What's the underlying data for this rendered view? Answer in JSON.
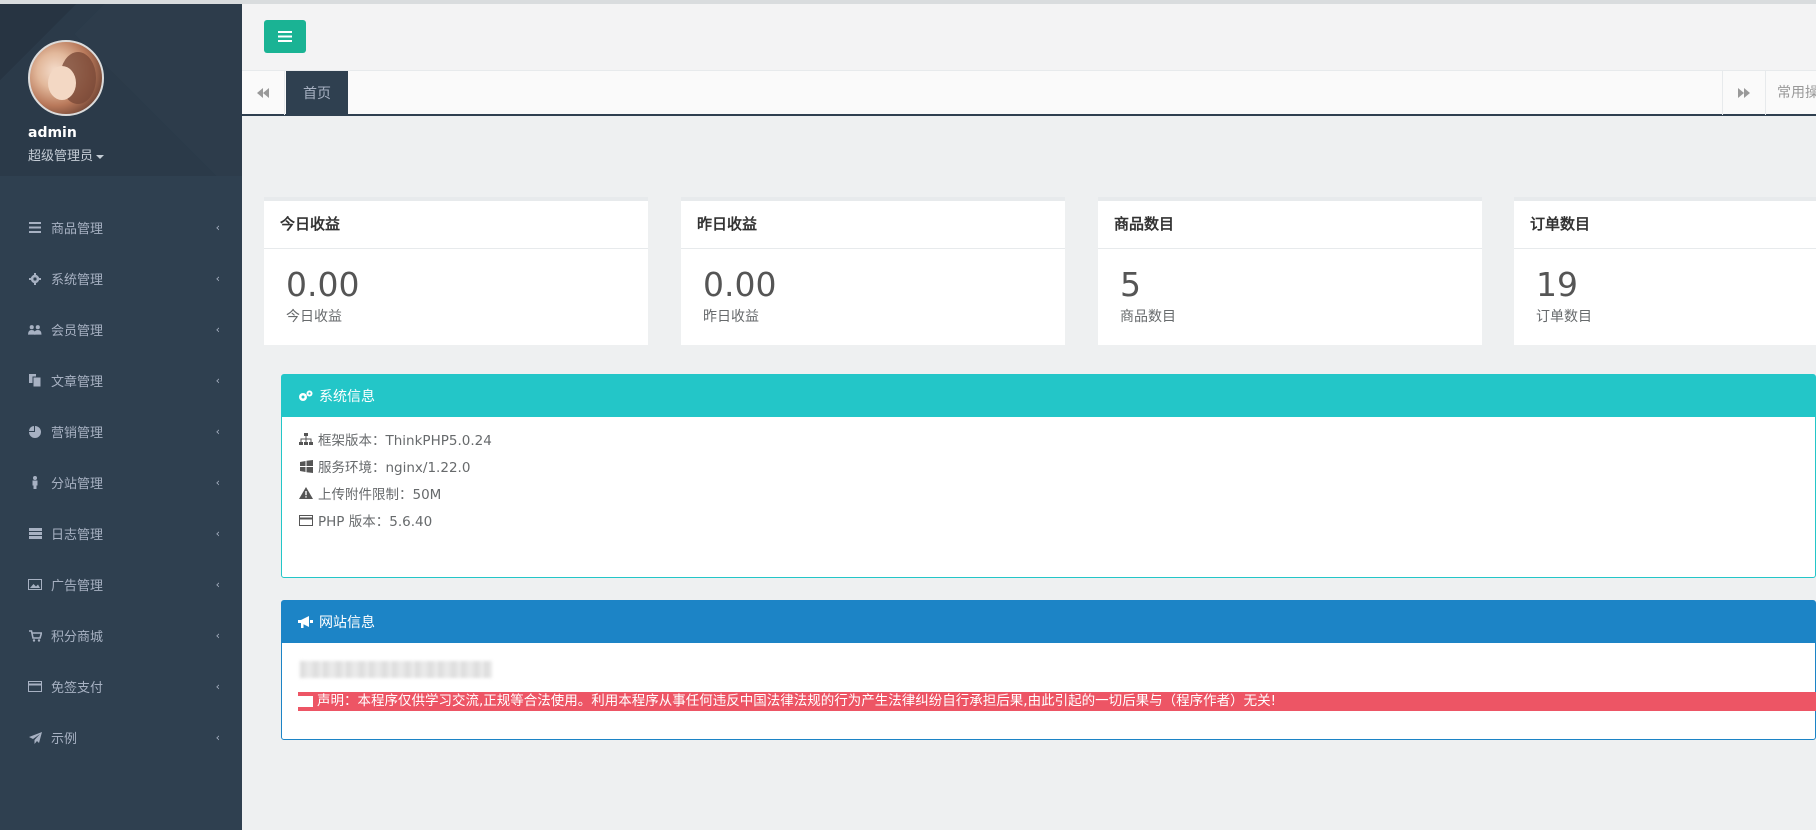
{
  "user": {
    "name": "admin",
    "role": "超级管理员"
  },
  "nav": [
    {
      "label": "商品管理",
      "icon": "list-icon"
    },
    {
      "label": "系统管理",
      "icon": "gear-icon"
    },
    {
      "label": "会员管理",
      "icon": "users-icon"
    },
    {
      "label": "文章管理",
      "icon": "files-icon"
    },
    {
      "label": "营销管理",
      "icon": "pie-chart-icon"
    },
    {
      "label": "分站管理",
      "icon": "street-view-icon"
    },
    {
      "label": "日志管理",
      "icon": "server-icon"
    },
    {
      "label": "广告管理",
      "icon": "picture-icon"
    },
    {
      "label": "积分商城",
      "icon": "cart-icon"
    },
    {
      "label": "免签支付",
      "icon": "credit-card-icon"
    },
    {
      "label": "示例",
      "icon": "paper-plane-icon"
    }
  ],
  "tabs": {
    "home": "首页",
    "ops": "常用操"
  },
  "cards": [
    {
      "title": "今日收益",
      "value": "0.00",
      "sub": "今日收益"
    },
    {
      "title": "昨日收益",
      "value": "0.00",
      "sub": "昨日收益"
    },
    {
      "title": "商品数目",
      "value": "5",
      "sub": "商品数目"
    },
    {
      "title": "订单数目",
      "value": "19",
      "sub": "订单数目"
    }
  ],
  "system_info": {
    "title": "系统信息",
    "rows": [
      "框架版本：ThinkPHP5.0.24",
      "服务环境：nginx/1.22.0",
      "上传附件限制：50M",
      "PHP 版本：5.6.40"
    ]
  },
  "site_info": {
    "title": "网站信息",
    "notice": "声明：本程序仅供学习交流,正规等合法使用。利用本程序从事任何违反中国法律法规的行为产生法律纠纷自行承担后果,由此引起的一切后果与（程序作者）无关!"
  },
  "colors": {
    "sidebar": "#2f4050",
    "primary": "#1ab394",
    "info": "#23c6c8",
    "success": "#1c84c6",
    "danger": "#ed5565"
  }
}
